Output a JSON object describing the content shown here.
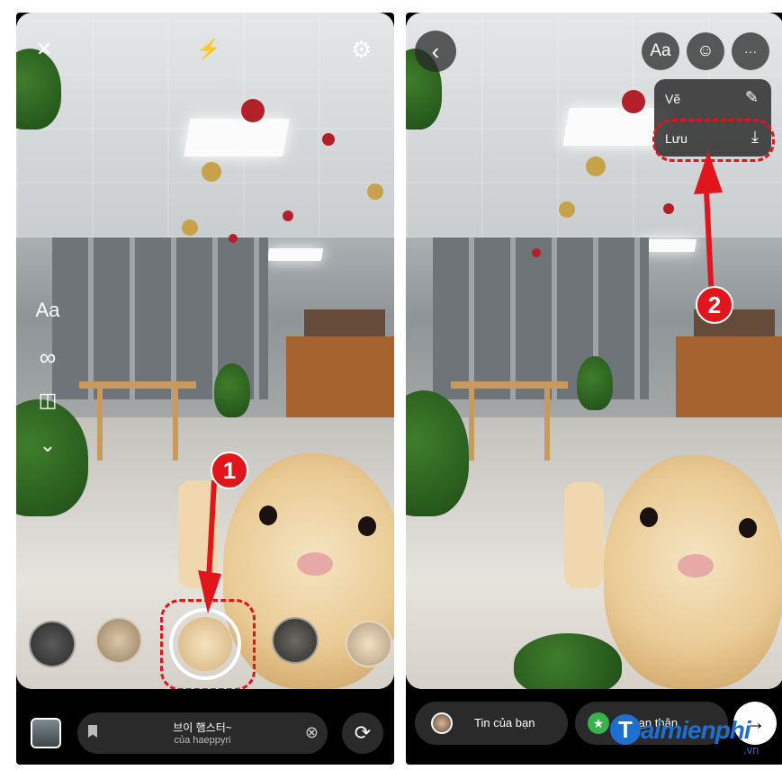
{
  "left": {
    "top_bar": {
      "close_icon": "✕",
      "flash_icon": "⚡",
      "settings_icon": "⚙"
    },
    "side_tools": [
      {
        "name": "text-tool",
        "label": "Aa"
      },
      {
        "name": "boomerang-tool",
        "label": "∞"
      },
      {
        "name": "layout-tool",
        "label": "◫"
      },
      {
        "name": "more-tools",
        "label": "⌄"
      }
    ],
    "step_marker": "1",
    "music": {
      "title": "브이 햄스터~",
      "artist": "của haeppyri",
      "remove_icon": "⊗"
    },
    "gallery_icon": "gallery-thumbnail",
    "flip_camera_icon": "⟳"
  },
  "right": {
    "top_bar": {
      "back_icon": "‹",
      "text_button": "Aa",
      "sticker_icon": "☺",
      "more_icon": "···"
    },
    "menu": [
      {
        "label": "Vẽ",
        "icon": "✎"
      },
      {
        "label": "Lưu",
        "icon": "⤓"
      }
    ],
    "step_marker": "2",
    "share": {
      "your_story": "Tin của bạn",
      "close_friends": "Bạn thân",
      "close_friends_icon": "★",
      "next_icon": "→"
    }
  },
  "watermark": {
    "brand": "aimienphi",
    "prefix": "T",
    "tld": ".vn"
  },
  "colors": {
    "highlight_red": "#e0161c",
    "brand_blue": "#1f6fd1"
  }
}
